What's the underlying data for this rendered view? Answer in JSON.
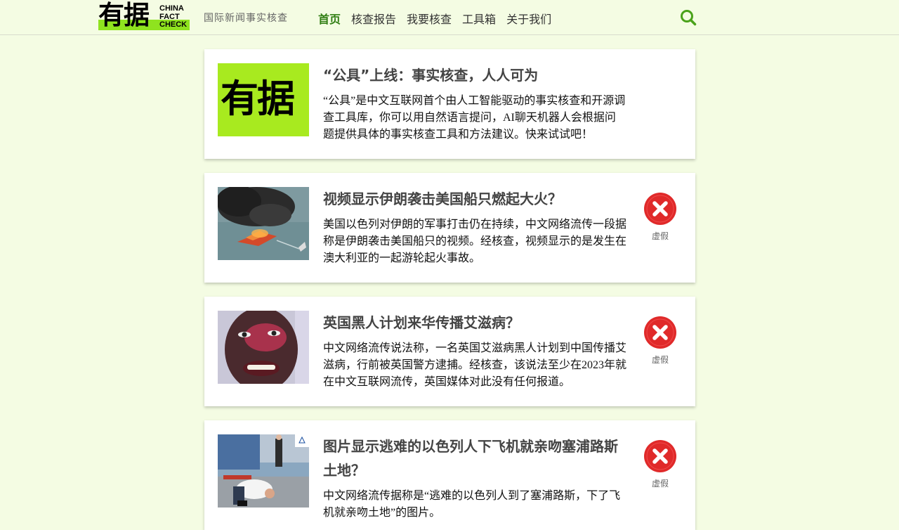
{
  "site": {
    "logo_han": "有据",
    "logo_en_1": "CHINA",
    "logo_en_2": "FACT",
    "logo_en_3": "CHECK",
    "tagline": "国际新闻事实核查"
  },
  "nav": {
    "items": [
      {
        "label": "首页"
      },
      {
        "label": "核查报告"
      },
      {
        "label": "我要核查"
      },
      {
        "label": "工具箱"
      },
      {
        "label": "关于我们"
      }
    ],
    "active_index": 0
  },
  "colors": {
    "brand_green": "#8fe31f",
    "active_nav": "#2f7d12",
    "page_bg": "#f4fce3",
    "verdict_red": "#e02a2a"
  },
  "articles": [
    {
      "title": "“公具”上线：事实核查，人人可为",
      "summary": "“公具”是中文互联网首个由人工智能驱动的事实核查和开源调查工具库，你可以用自然语言提问，AI聊天机器人会根据问题提供具体的事实核查工具和方法建议。快来试试吧！",
      "thumb_text": "有据"
    },
    {
      "title": "视频显示伊朗袭击美国船只燃起大火？",
      "summary": "美国以色列对伊朗的军事打击仍在持续，中文网络流传一段据称是伊朗袭击美国船只的视频。经核查，视频显示的是发生在澳大利亚的一起游轮起火事故。",
      "verdict": "虚假"
    },
    {
      "title": "英国黑人计划来华传播艾滋病？",
      "summary": "中文网络流传说法称，一名英国艾滋病黑人计划到中国传播艾滋病，行前被英国警方逮捕。经核查，该说法至少在2023年就在中文互联网流传，英国媒体对此没有任何报道。",
      "verdict": "虚假"
    },
    {
      "title": "图片显示逃难的以色列人下飞机就亲吻塞浦路斯土地？",
      "summary": "中文网络流传据称是“逃难的以色列人到了塞浦路斯，下了飞机就亲吻土地”的图片。",
      "verdict": "虚假"
    }
  ]
}
